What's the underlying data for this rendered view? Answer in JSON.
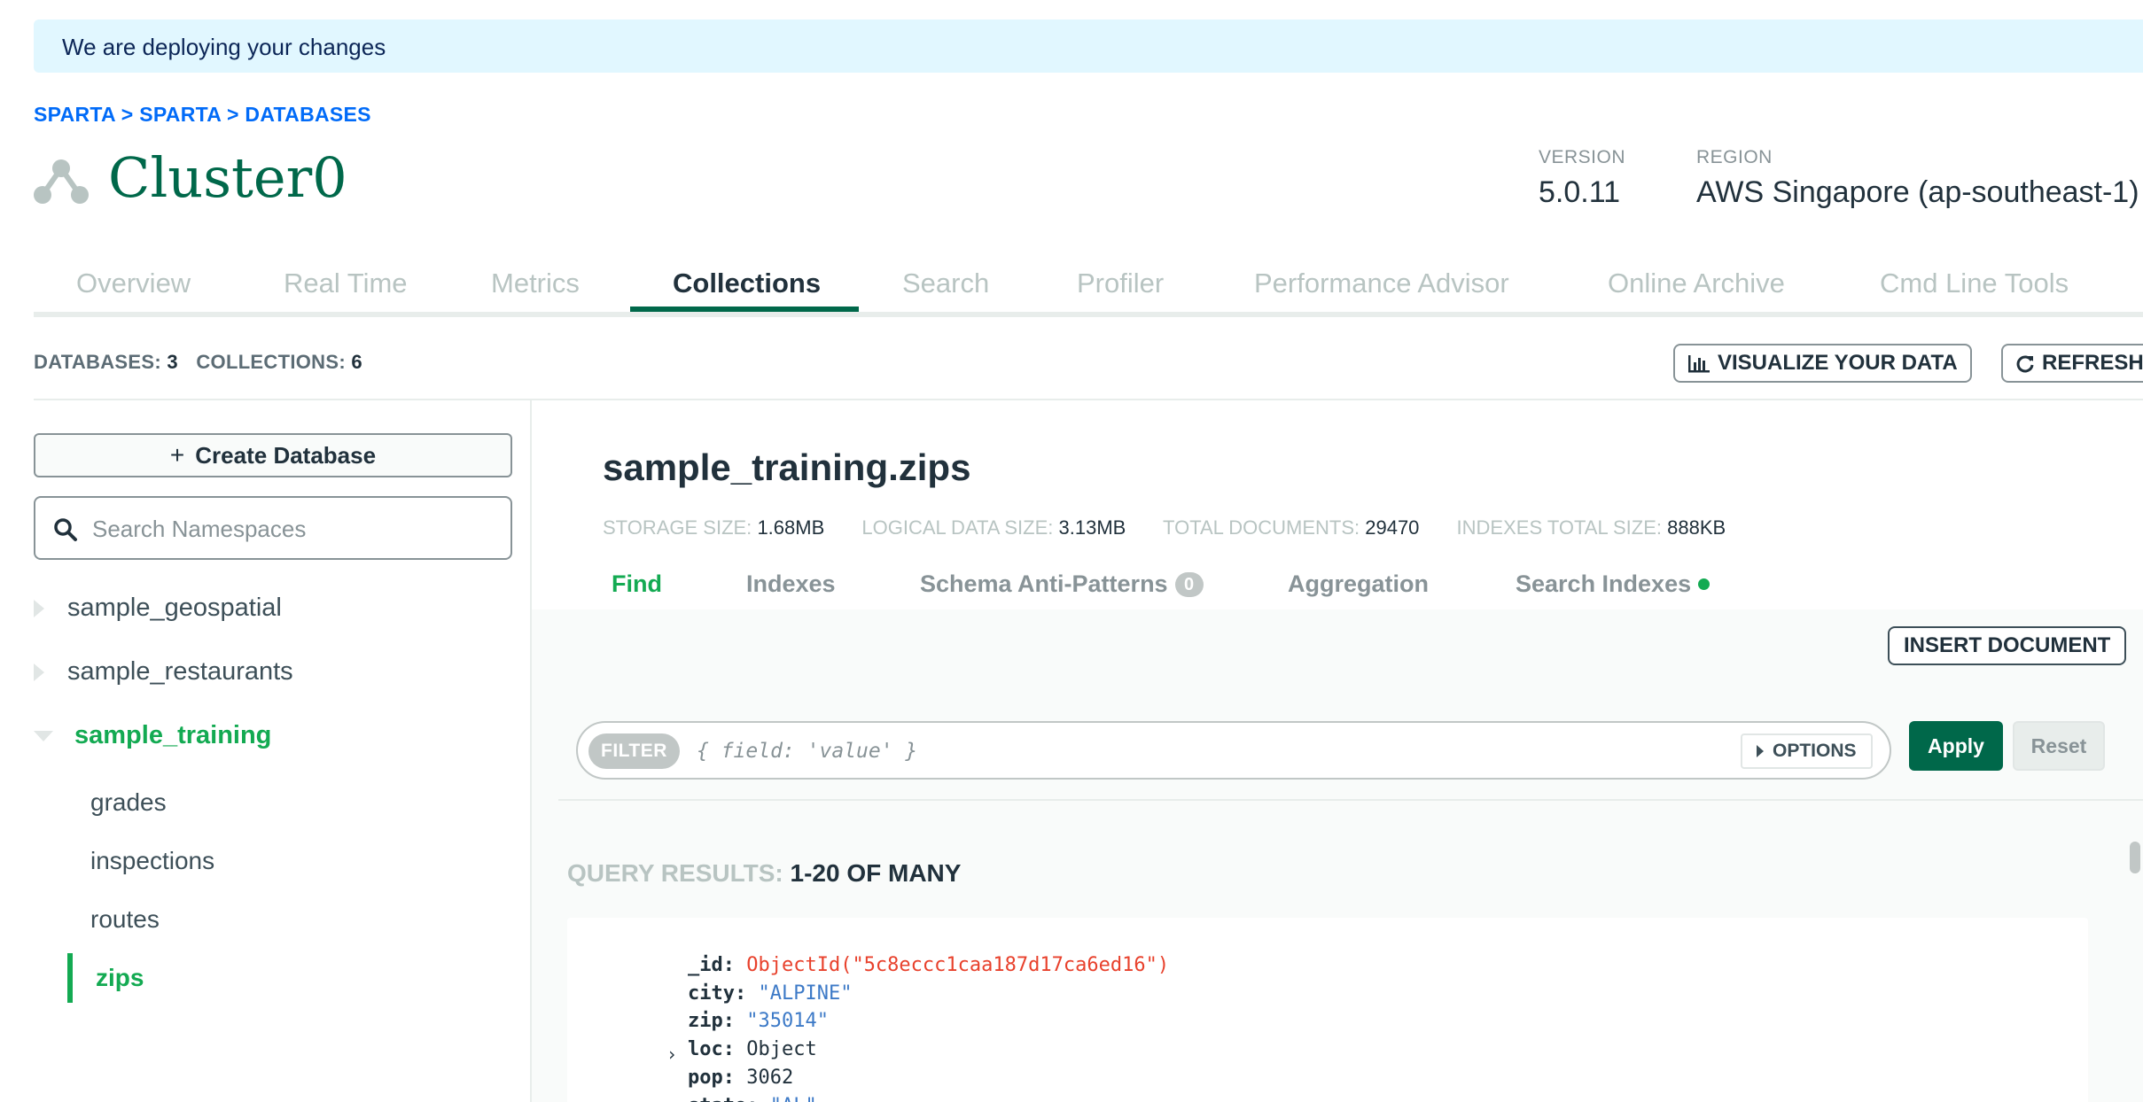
{
  "banner": {
    "text": "We are deploying your changes"
  },
  "breadcrumb": {
    "text": "SPARTA > SPARTA > DATABASES"
  },
  "cluster": {
    "name": "Cluster0"
  },
  "meta": {
    "version_label": "VERSION",
    "version_value": "5.0.11",
    "region_label": "REGION",
    "region_value": "AWS Singapore (ap-southeast-1)"
  },
  "tabs": [
    {
      "label": "Overview"
    },
    {
      "label": "Real Time"
    },
    {
      "label": "Metrics"
    },
    {
      "label": "Collections",
      "active": true
    },
    {
      "label": "Search"
    },
    {
      "label": "Profiler"
    },
    {
      "label": "Performance Advisor"
    },
    {
      "label": "Online Archive"
    },
    {
      "label": "Cmd Line Tools"
    }
  ],
  "stats": {
    "databases_label": "DATABASES:",
    "databases_value": "3",
    "collections_label": "COLLECTIONS:",
    "collections_value": "6"
  },
  "toolbar": {
    "visualize_label": "VISUALIZE YOUR DATA",
    "refresh_label": "REFRESH"
  },
  "sidebar": {
    "create_label": "Create Database",
    "search_placeholder": "Search Namespaces",
    "databases": [
      {
        "name": "sample_geospatial",
        "expanded": false
      },
      {
        "name": "sample_restaurants",
        "expanded": false
      },
      {
        "name": "sample_training",
        "expanded": true
      }
    ],
    "collections": [
      {
        "name": "grades"
      },
      {
        "name": "inspections"
      },
      {
        "name": "routes"
      },
      {
        "name": "zips",
        "active": true
      }
    ]
  },
  "namespace": {
    "title": "sample_training.zips",
    "storage_label": "STORAGE SIZE:",
    "storage_value": "1.68MB",
    "logical_label": "LOGICAL DATA SIZE:",
    "logical_value": "3.13MB",
    "docs_label": "TOTAL DOCUMENTS:",
    "docs_value": "29470",
    "indexes_label": "INDEXES TOTAL SIZE:",
    "indexes_value": "888KB"
  },
  "subtabs": {
    "find": "Find",
    "indexes": "Indexes",
    "schema": "Schema Anti-Patterns",
    "schema_count": "0",
    "aggregation": "Aggregation",
    "search_indexes": "Search Indexes"
  },
  "actions": {
    "insert_label": "INSERT DOCUMENT",
    "filter_label": "FILTER",
    "filter_placeholder": "{ field: 'value' }",
    "options_label": "OPTIONS",
    "apply_label": "Apply",
    "reset_label": "Reset"
  },
  "results": {
    "label": "QUERY RESULTS:",
    "range": "1-20 OF MANY"
  },
  "document": {
    "fields": [
      {
        "key": "_id:",
        "value": "ObjectId(\"5c8eccc1caa187d17ca6ed16\")",
        "type": "oid"
      },
      {
        "key": "city:",
        "value": "\"ALPINE\"",
        "type": "str"
      },
      {
        "key": "zip:",
        "value": "\"35014\"",
        "type": "str"
      },
      {
        "key": "loc:",
        "value": "Object",
        "type": "obj"
      },
      {
        "key": "pop:",
        "value": "3062",
        "type": "num"
      },
      {
        "key": "state:",
        "value": "\"AL\"",
        "type": "str"
      }
    ]
  },
  "colors": {
    "brand_green": "#00684a",
    "accent_green": "#13aa52",
    "link_blue": "#016bf8",
    "banner_bg": "#e1f7ff"
  }
}
